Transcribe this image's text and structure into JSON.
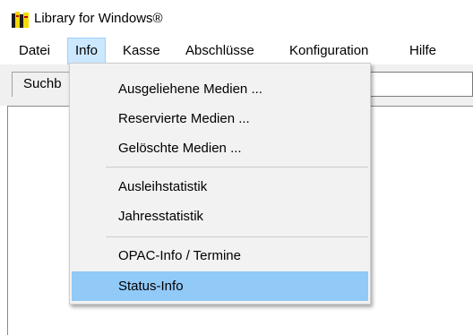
{
  "window": {
    "title": "Library for Windows®",
    "icon": "books-icon"
  },
  "menubar": {
    "items": [
      {
        "label": "Datei",
        "active": false
      },
      {
        "label": "Info",
        "active": true
      },
      {
        "label": "Kasse",
        "active": false
      },
      {
        "label": "Abschlüsse",
        "active": false
      },
      {
        "label": "Konfiguration",
        "active": false
      },
      {
        "label": "Hilfe",
        "active": false
      }
    ]
  },
  "toolbar": {
    "search_label": "Suchb"
  },
  "dropdown": {
    "items": [
      {
        "label": "Ausgeliehene Medien ...",
        "highlighted": false
      },
      {
        "label": "Reservierte Medien ...",
        "highlighted": false
      },
      {
        "label": "Gelöschte Medien ...",
        "highlighted": false
      },
      {
        "label": "Ausleihstatistik",
        "highlighted": false
      },
      {
        "label": "Jahresstatistik",
        "highlighted": false
      },
      {
        "label": "OPAC-Info / Termine",
        "highlighted": false
      },
      {
        "label": "Status-Info",
        "highlighted": true
      }
    ]
  },
  "colors": {
    "menu_active_bg": "#cce8ff",
    "item_highlight_bg": "#91c9f7",
    "dropdown_bg": "#f2f2f2"
  }
}
